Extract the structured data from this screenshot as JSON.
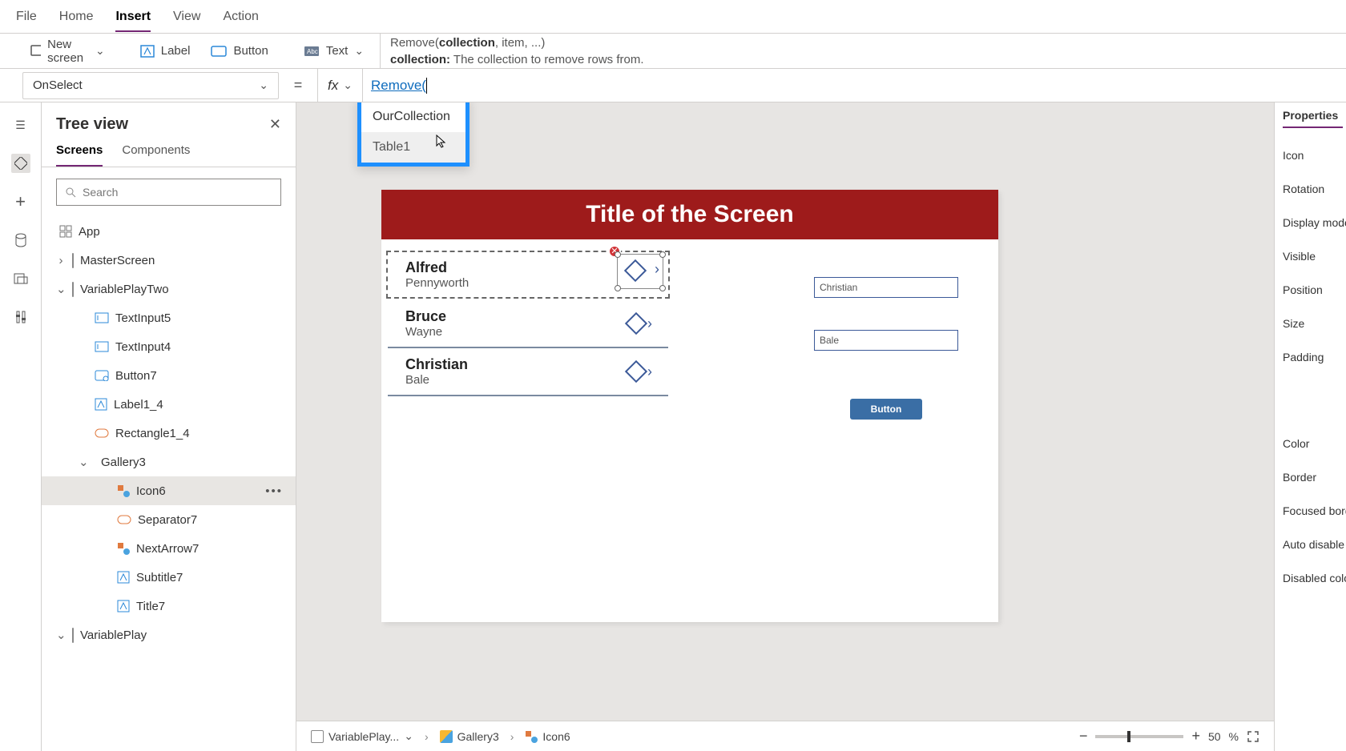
{
  "menu": {
    "items": [
      "File",
      "Home",
      "Insert",
      "View",
      "Action"
    ],
    "active": "Insert"
  },
  "ribbon": {
    "newScreen": "New screen",
    "label": "Label",
    "button": "Button",
    "text": "Text",
    "helpSignature": "Remove(collection, item, ...)",
    "helpSigPrefix": "Remove(",
    "helpSigBold": "collection",
    "helpSigRest": ", item, ...)",
    "helpParamName": "collection:",
    "helpParamDesc": "The collection to remove rows from."
  },
  "formula": {
    "property": "OnSelect",
    "fx": "fx",
    "text": "Remove("
  },
  "intellisense": {
    "options": [
      "OurCollection",
      "Table1"
    ]
  },
  "tree": {
    "title": "Tree view",
    "tabs": [
      "Screens",
      "Components"
    ],
    "activeTab": "Screens",
    "searchPlaceholder": "Search",
    "app": "App",
    "nodes": [
      {
        "label": "MasterScreen",
        "indent": 0,
        "caret": "›",
        "icon": "screen"
      },
      {
        "label": "VariablePlayTwo",
        "indent": 0,
        "caret": "⌄",
        "icon": "screen"
      },
      {
        "label": "TextInput5",
        "indent": 1,
        "icon": "textinput"
      },
      {
        "label": "TextInput4",
        "indent": 1,
        "icon": "textinput"
      },
      {
        "label": "Button7",
        "indent": 1,
        "icon": "button"
      },
      {
        "label": "Label1_4",
        "indent": 1,
        "icon": "label"
      },
      {
        "label": "Rectangle1_4",
        "indent": 1,
        "icon": "rect"
      },
      {
        "label": "Gallery3",
        "indent": 1,
        "caret": "⌄",
        "icon": "gallery"
      },
      {
        "label": "Icon6",
        "indent": 2,
        "icon": "group",
        "selected": true
      },
      {
        "label": "Separator7",
        "indent": 2,
        "icon": "rect"
      },
      {
        "label": "NextArrow7",
        "indent": 2,
        "icon": "group"
      },
      {
        "label": "Subtitle7",
        "indent": 2,
        "icon": "label"
      },
      {
        "label": "Title7",
        "indent": 2,
        "icon": "label"
      },
      {
        "label": "VariablePlay",
        "indent": 0,
        "caret": "⌄",
        "icon": "screen"
      }
    ]
  },
  "canvas": {
    "title": "Title of the Screen",
    "gallery": [
      {
        "first": "Alfred",
        "last": "Pennyworth",
        "selected": true
      },
      {
        "first": "Bruce",
        "last": "Wayne"
      },
      {
        "first": "Christian",
        "last": "Bale"
      }
    ],
    "input1": "Christian",
    "input2": "Bale",
    "button": "Button"
  },
  "breadcrumb": {
    "screen": "VariablePlay...",
    "gallery": "Gallery3",
    "control": "Icon6"
  },
  "zoom": {
    "value": "50",
    "unit": "%"
  },
  "props": {
    "tab": "Properties",
    "rows": [
      "Icon",
      "Rotation",
      "Display mode",
      "Visible",
      "Position",
      "Size",
      "Padding",
      "Color",
      "Border",
      "Focused border",
      "Auto disable",
      "Disabled color"
    ]
  }
}
